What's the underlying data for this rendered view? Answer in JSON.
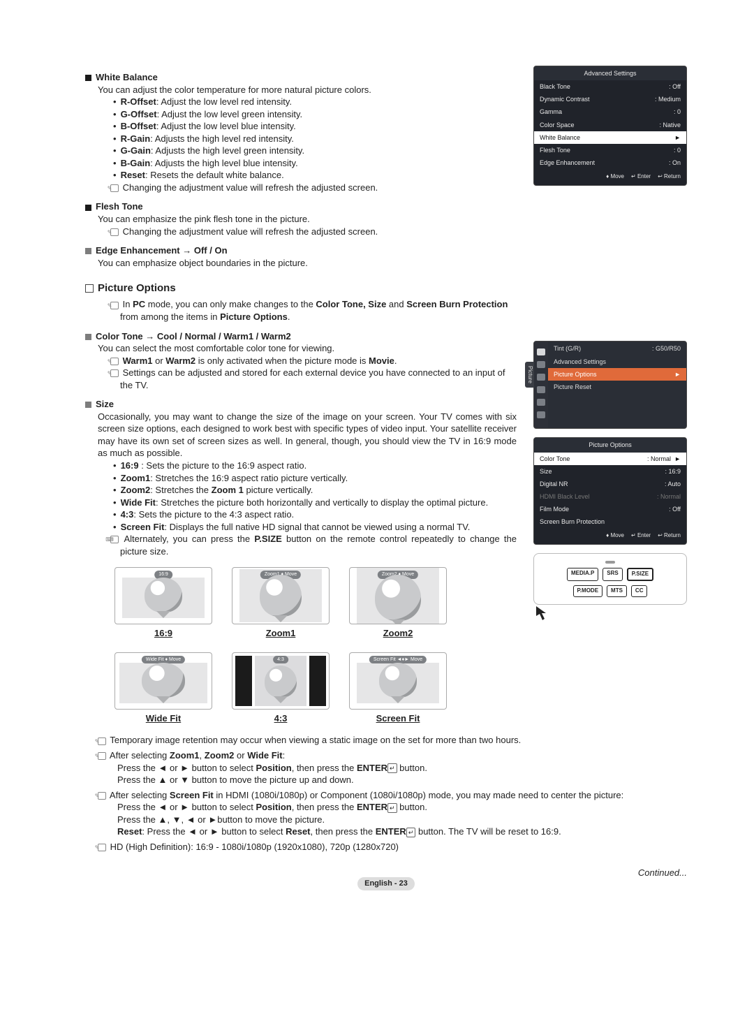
{
  "white_balance": {
    "title": "White Balance",
    "desc": "You can adjust the color temperature for more natural picture colors.",
    "items": [
      {
        "k": "R-Offset",
        "v": ": Adjust the low level red intensity."
      },
      {
        "k": "G-Offset",
        "v": ": Adjust the low level green intensity."
      },
      {
        "k": "B-Offset",
        "v": ": Adjust the low level blue intensity."
      },
      {
        "k": "R-Gain",
        "v": ": Adjusts the high level red intensity."
      },
      {
        "k": "G-Gain",
        "v": ": Adjusts the high level green intensity."
      },
      {
        "k": "B-Gain",
        "v": ": Adjusts the high level blue intensity."
      },
      {
        "k": "Reset",
        "v": ": Resets the default white balance."
      }
    ],
    "note": "Changing the adjustment value will refresh the adjusted screen."
  },
  "flesh_tone": {
    "title": "Flesh Tone",
    "desc": "You can emphasize the pink flesh tone in the picture.",
    "note": "Changing the adjustment value will refresh the adjusted screen."
  },
  "edge": {
    "title": "Edge Enhancement → Off / On",
    "desc": "You can emphasize object boundaries in the picture."
  },
  "picture_options": {
    "title": "Picture Options",
    "pc_note_pre": "In ",
    "pc_note_bold1": "PC",
    "pc_note_mid": " mode, you can only make changes to the ",
    "pc_note_bold2": "Color Tone, Size",
    "pc_note_mid2": " and ",
    "pc_note_bold3": "Screen Burn Protection",
    "pc_note_end": " from among the items in ",
    "pc_note_bold4": "Picture Options",
    "pc_note_dot": "."
  },
  "color_tone": {
    "title": "Color Tone → Cool / Normal / Warm1 / Warm2",
    "desc": "You can select the most comfortable color tone for viewing.",
    "note1_pre": "",
    "note1_bold": "Warm1",
    "note1_mid": " or ",
    "note1_bold2": "Warm2",
    "note1_mid2": " is only activated when the picture mode is ",
    "note1_bold3": "Movie",
    "note1_end": ".",
    "note2": "Settings can be adjusted and stored for each external device you have connected to an input of the TV."
  },
  "size": {
    "title": "Size",
    "para": "Occasionally, you may want to change the size of the image on your screen. Your TV comes with six screen size options, each designed to work best with specific types of video input. Your satellite receiver may have its own set of screen sizes as well. In general, though, you should view the TV in 16:9 mode as much as possible.",
    "items": [
      {
        "k": "16:9",
        "v": " : Sets the picture to the 16:9 aspect ratio."
      },
      {
        "k": "Zoom1",
        "v": ": Stretches the 16:9 aspect ratio picture vertically."
      },
      {
        "k": "Zoom2",
        "v": ": Stretches the ",
        "bold": "Zoom 1",
        "vend": " picture vertically."
      },
      {
        "k": "Wide Fit",
        "v": ": Stretches the picture both horizontally and vertically to display the optimal picture."
      },
      {
        "k": "4:3",
        "v": ": Sets the picture to the 4:3 aspect ratio."
      },
      {
        "k": "Screen Fit",
        "v": ": Displays the full native HD signal that cannot be viewed using a normal TV."
      }
    ],
    "psize_pre": "Alternately, you can press the ",
    "psize_bold": "P.SIZE",
    "psize_end": " button on the remote control repeatedly to change the picture size."
  },
  "diagram_labels": {
    "a": "16:9",
    "b": "Zoom1",
    "c": "Zoom2",
    "d": "Wide Fit",
    "e": "4:3",
    "f": "Screen Fit",
    "tags": {
      "a": "16:9",
      "b": "Zoom1 ♦ Move",
      "c": "Zoom2 ♦ Move",
      "d": "Wide Fit ♦ Move",
      "e": "4:3",
      "f": "Screen Fit ◄♦► Move"
    }
  },
  "bottom_notes": {
    "n1": "Temporary image retention may occur when viewing a static image on the set for more than two hours.",
    "n2_pre": "After selecting ",
    "n2_bold": "Zoom1",
    "n2_mid": ", ",
    "n2_bold2": "Zoom2",
    "n2_mid2": " or ",
    "n2_bold3": "Wide Fit",
    "n2_end": ":",
    "n2_sub1_pre": "Press the ◄ or ► button to select ",
    "n2_sub1_bold": "Position",
    "n2_sub1_mid": ", then press the ",
    "n2_sub1_bold2": "ENTER",
    "n2_sub1_end": " button.",
    "n2_sub2": "Press the ▲ or ▼ button to move the picture up and down.",
    "n3_pre": "After selecting ",
    "n3_bold": "Screen Fit",
    "n3_end": " in HDMI (1080i/1080p) or Component (1080i/1080p) mode, you may made need to center the picture:",
    "n3_sub1_pre": "Press the ◄ or ► button to select ",
    "n3_sub1_bold": "Position",
    "n3_sub1_mid": ", then press the ",
    "n3_sub1_bold2": "ENTER",
    "n3_sub1_end": " button.",
    "n3_sub2": "Press the ▲, ▼, ◄ or ►button to move the picture.",
    "n3_sub3_pre": "",
    "n3_sub3_bold": "Reset",
    "n3_sub3_mid": ": Press the ◄ or ► button to select ",
    "n3_sub3_bold2": "Reset",
    "n3_sub3_mid2": ", then press the ",
    "n3_sub3_bold3": "ENTER",
    "n3_sub3_end": " button. The TV will be reset to 16:9.",
    "n4": "HD (High Definition): 16:9 - 1080i/1080p (1920x1080), 720p (1280x720)"
  },
  "continued": "Continued...",
  "footer": "English - 23",
  "menu_adv": {
    "title": "Advanced Settings",
    "rows": [
      {
        "k": "Black Tone",
        "v": ": Off"
      },
      {
        "k": "Dynamic Contrast",
        "v": ": Medium"
      },
      {
        "k": "Gamma",
        "v": ": 0"
      },
      {
        "k": "Color Space",
        "v": ": Native"
      }
    ],
    "sel": "White Balance",
    "selArrow": "►",
    "rows2": [
      {
        "k": "Flesh Tone",
        "v": ": 0"
      },
      {
        "k": "Edge Enhancement",
        "v": ": On"
      }
    ],
    "footer": {
      "move": "♦ Move",
      "enter": "↵ Enter",
      "return": "↩ Return"
    }
  },
  "menu_pic": {
    "side": "Picture",
    "top": {
      "k": "Tint (G/R)",
      "v": ": G50/R50"
    },
    "adv": "Advanced Settings",
    "sel": "Picture Options",
    "selArrow": "►",
    "reset": "Picture Reset"
  },
  "menu_po": {
    "title": "Picture Options",
    "rows": [
      {
        "k": "Color Tone",
        "v": ": Normal",
        "sel": true
      },
      {
        "k": "Size",
        "v": ": 16:9"
      },
      {
        "k": "Digital NR",
        "v": ": Auto"
      },
      {
        "k": "HDMI Black Level",
        "v": ": Normal",
        "dim": true
      },
      {
        "k": "Film Mode",
        "v": ": Off"
      },
      {
        "k": "Screen Burn Protection",
        "v": ""
      }
    ],
    "footer": {
      "move": "♦ Move",
      "enter": "↵ Enter",
      "return": "↩ Return"
    }
  },
  "remote": {
    "row1": [
      "MEDIA.P",
      "SRS",
      "P.SIZE"
    ],
    "row2": [
      "P.MODE",
      "MTS",
      "CC"
    ]
  }
}
